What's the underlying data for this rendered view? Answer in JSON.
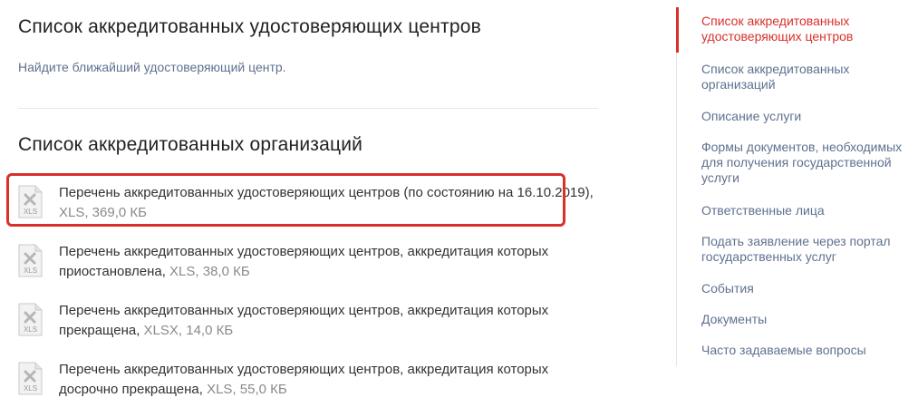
{
  "main": {
    "title": "Список аккредитованных удостоверяющих центров",
    "find_link": "Найдите ближайший удостоверяющий центр.",
    "section_title": "Список аккредитованных организаций",
    "files": [
      {
        "name": "Перечень аккредитованных удостоверяющих центров (по состоянию на 16.10.2019),",
        "meta": " XLS,  369,0 КБ",
        "icon": "xls-file-icon",
        "icon_label": "XLS"
      },
      {
        "name": "Перечень аккредитованных удостоверяющих центров, аккредитация которых приостановлена,",
        "meta": " XLS,  38,0 КБ",
        "icon": "xls-file-icon",
        "icon_label": "XLS"
      },
      {
        "name": "Перечень аккредитованных удостоверяющих центров, аккредитация которых прекращена,",
        "meta": " XLSX,  14,0 КБ",
        "icon": "xls-file-icon",
        "icon_label": "XLS"
      },
      {
        "name": "Перечень аккредитованных удостоверяющих центров, аккредитация которых досрочно прекращена,",
        "meta": " XLS,  55,0 КБ",
        "icon": "xls-file-icon",
        "icon_label": "XLS"
      }
    ]
  },
  "sidebar": {
    "items": [
      {
        "label": "Список аккредитованных удостоверяющих центров",
        "active": true
      },
      {
        "label": "Список аккредитованных организаций",
        "active": false
      },
      {
        "label": "Описание услуги",
        "active": false
      },
      {
        "label": "Формы документов, необходимых для получения государственной услуги",
        "active": false
      },
      {
        "label": "Ответственные лица",
        "active": false
      },
      {
        "label": "Подать заявление через портал государственных услуг",
        "active": false
      },
      {
        "label": "События",
        "active": false
      },
      {
        "label": "Документы",
        "active": false
      },
      {
        "label": "Часто задаваемые вопросы",
        "active": false
      }
    ]
  },
  "colors": {
    "accent_red": "#d9302b",
    "link_blue_gray": "#5f7190",
    "meta_gray": "#8a8a8a"
  }
}
